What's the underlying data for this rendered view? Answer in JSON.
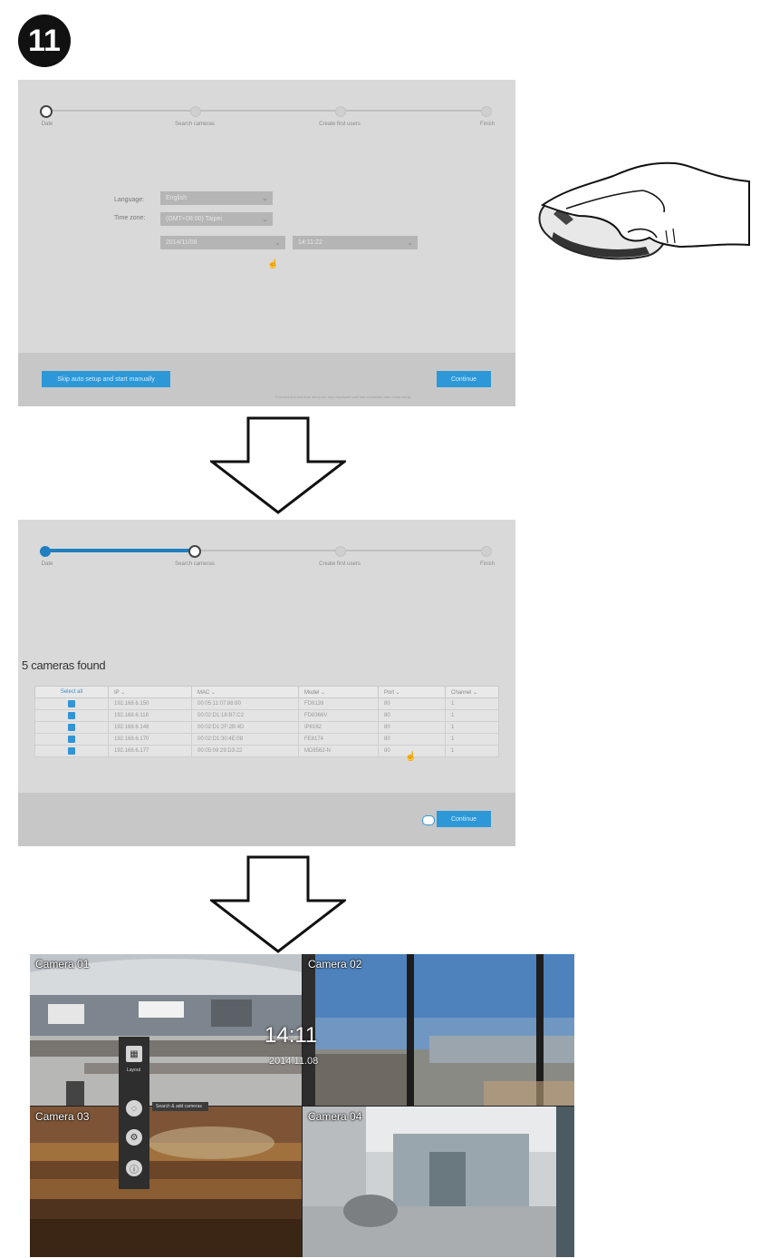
{
  "badge": "11",
  "wizard_steps": [
    "Date",
    "Search cameras",
    "Create first users",
    "Finish"
  ],
  "screen1": {
    "language_label": "Language:",
    "timezone_label": "Time zone:",
    "language_value": "English",
    "timezone_value": "(GMT+08:00) Taipei",
    "date_value": "2014/11/08",
    "time_value": "14:11:22",
    "skip_button": "Skip auto setup and start manually",
    "continue_button": "Continue",
    "note": "Connect and first time setup are only displayed until first connected after initial setup."
  },
  "screen2": {
    "found_title": "5 cameras found",
    "columns": [
      "Select all",
      "IP",
      "MAC",
      "Model",
      "Port",
      "Channel"
    ],
    "rows": [
      {
        "ip": "192.168.6.150",
        "mac": "00:05:11:07:88:80",
        "model": "FD8139",
        "port": "80",
        "channel": "1"
      },
      {
        "ip": "192.168.6.118",
        "mac": "00:02:D1:18:B7:C2",
        "model": "FD8366V",
        "port": "80",
        "channel": "1"
      },
      {
        "ip": "192.168.6.148",
        "mac": "00:02:D1:2F:2B:4D",
        "model": "IP8162",
        "port": "80",
        "channel": "1"
      },
      {
        "ip": "192.168.6.170",
        "mac": "00:02:D1:30:4E:08",
        "model": "FE8174",
        "port": "80",
        "channel": "1"
      },
      {
        "ip": "192.168.6.177",
        "mac": "00:05:09:29:D3:22",
        "model": "MD8562-N",
        "port": "80",
        "channel": "1"
      }
    ],
    "continue_button": "Continue"
  },
  "live": {
    "cameras": [
      "Camera 01",
      "Camera 02",
      "Camera 03",
      "Camera 04"
    ],
    "clock_time": "14:11",
    "clock_date": "2014.11.08",
    "menu_label": "Layout",
    "tooltip": "Search & add cameras"
  },
  "colors": {
    "accent": "#2d98d8",
    "panel": "#d9d9d9",
    "footer": "#c7c7c7"
  }
}
